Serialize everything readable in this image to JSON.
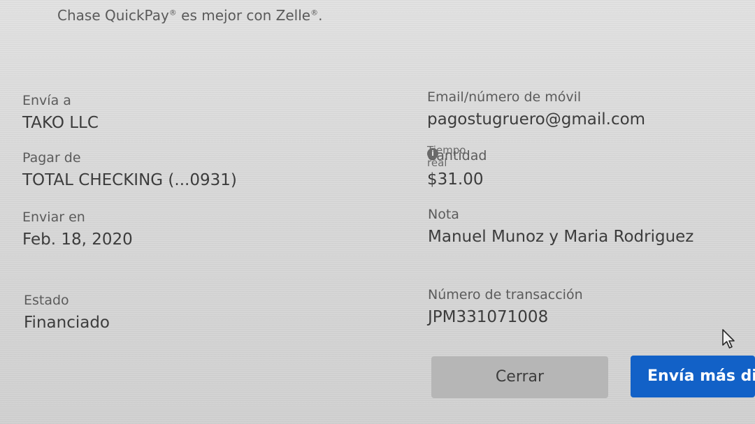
{
  "header": {
    "brand": "Chase QuickPay",
    "reg_mark": "®",
    "middle": " es mejor con Zelle",
    "reg_mark2": "®",
    "end": "."
  },
  "details": {
    "recipient": {
      "label": "Envía a",
      "value": "TAKO LLC"
    },
    "pay_from": {
      "label": "Pagar de",
      "value": "TOTAL CHECKING (...0931)"
    },
    "send_on": {
      "label": "Enviar en",
      "value": "Feb. 18, 2020"
    },
    "status": {
      "label": "Estado",
      "value": "Financiado"
    },
    "contact": {
      "label": "Email/número de móvil",
      "value": "pagostugruero@gmail.com"
    },
    "amount": {
      "overlay_label": "Tiempo real",
      "label": "Cantidad",
      "value": "$31.00"
    },
    "note": {
      "label": "Nota",
      "value": "Manuel Munoz y Maria Rodriguez"
    },
    "transaction": {
      "label": "Número de transacción",
      "value": "JPM331071008"
    }
  },
  "buttons": {
    "close_label": "Cerrar",
    "send_more_label": "Envía más di"
  },
  "icons": {
    "info": "info-icon",
    "cursor": "mouse-pointer-icon"
  },
  "colors": {
    "primary": "#1261c7",
    "secondary_button": "#b6b6b6"
  }
}
